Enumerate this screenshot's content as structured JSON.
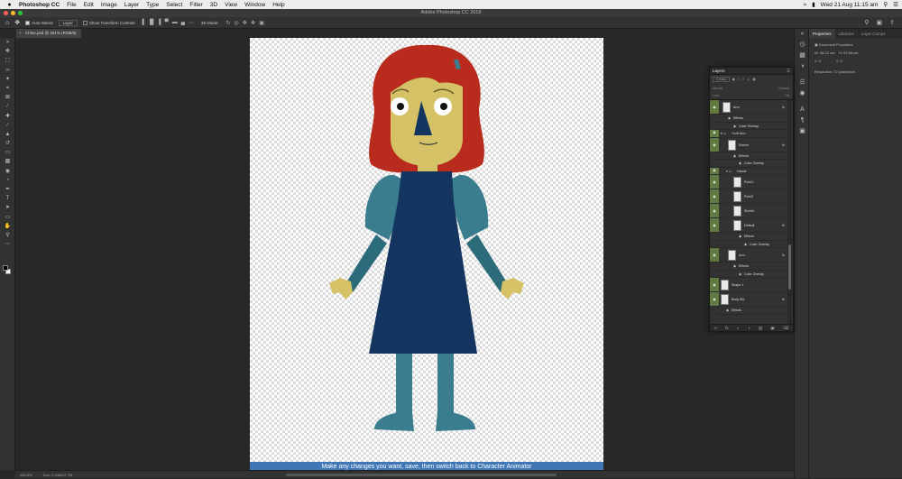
{
  "menubar": {
    "app_name": "Photoshop CC",
    "items": [
      "File",
      "Edit",
      "Image",
      "Layer",
      "Type",
      "Select",
      "Filter",
      "3D",
      "View",
      "Window",
      "Help"
    ],
    "clock": "Wed 21 Aug  11:15 am"
  },
  "window": {
    "title": "Adobe Photoshop CC 2019"
  },
  "options": {
    "auto_select_label": "Auto-Select:",
    "auto_select_value": "Layer",
    "transform_label": "Show Transform Controls",
    "mode_label": "3D Mode:"
  },
  "document": {
    "tab_label": "Chloe.psd @ 251% (RGB/8)"
  },
  "canvas": {
    "banner_text": "Make any changes you want, save, then switch back to Character Animator"
  },
  "status": {
    "zoom": "250.8%",
    "doc": "Doc: 2.43M/37.7M"
  },
  "properties": {
    "tabs": [
      "Properties",
      "Libraries",
      "Layer Comps"
    ],
    "heading": "Document Properties",
    "w_label": "W:",
    "w_value": "38.22 cm",
    "h_label": "H:",
    "h_value": "57.68 cm",
    "x_label": "X:",
    "x_value": "0",
    "y_label": "Y:",
    "y_value": "0",
    "resolution": "Resolution: 72 pixels/inch"
  },
  "layers": {
    "title": "Layers",
    "kind_label": "Kind",
    "blend_label": "Normal",
    "opacity_label": "Opacity:",
    "lock_label": "Lock:",
    "fill_label": "Fill:",
    "rows": [
      {
        "name": "Arm",
        "type": "layer",
        "fx": "fx",
        "indent": 12
      },
      {
        "name": "Effects",
        "type": "sub",
        "indent": 18
      },
      {
        "name": "Color Overlay",
        "type": "sub",
        "indent": 24
      },
      {
        "name": "+Left Arm",
        "type": "group",
        "indent": 10
      },
      {
        "name": "Sleeve",
        "type": "layer",
        "fx": "fx",
        "indent": 18
      },
      {
        "name": "Effects",
        "type": "sub",
        "indent": 24
      },
      {
        "name": "Color Overlay",
        "type": "sub",
        "indent": 30
      },
      {
        "name": "Hands",
        "type": "group",
        "indent": 16
      },
      {
        "name": "Point1",
        "type": "layer",
        "indent": 24
      },
      {
        "name": "Point2",
        "type": "layer",
        "indent": 24
      },
      {
        "name": "Stretch",
        "type": "layer",
        "indent": 24
      },
      {
        "name": "Default",
        "type": "layer",
        "fx": "fx",
        "indent": 24
      },
      {
        "name": "Effects",
        "type": "sub",
        "indent": 30
      },
      {
        "name": "Color Overlay",
        "type": "sub",
        "indent": 36
      },
      {
        "name": "Arm",
        "type": "layer",
        "fx": "fx",
        "indent": 18
      },
      {
        "name": "Effects",
        "type": "sub",
        "indent": 24
      },
      {
        "name": "Color Overlay",
        "type": "sub",
        "indent": 30
      },
      {
        "name": "Shape 1",
        "type": "layer",
        "indent": 10
      },
      {
        "name": "Body BG",
        "type": "layer",
        "fx": "fx",
        "indent": 10
      },
      {
        "name": "Effects",
        "type": "sub",
        "indent": 16
      }
    ]
  },
  "colors": {
    "hair": "#b92b1c",
    "skin": "#d5c266",
    "dress": "#13355f",
    "sleeve": "#3a7d8e",
    "banner": "#3f77b7",
    "visibility": "#627a3f"
  }
}
